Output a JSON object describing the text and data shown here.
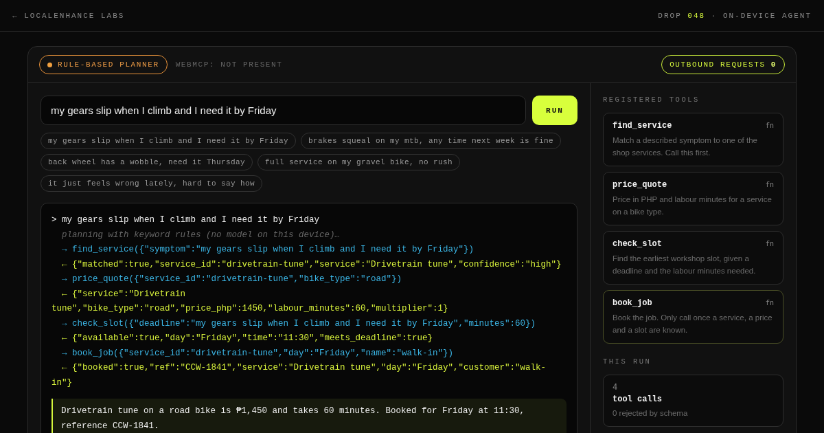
{
  "topbar": {
    "back_link": "← LOCALENHANCE LABS",
    "drop_label": "DROP",
    "drop_number": "048",
    "drop_suffix": "· ON-DEVICE AGENT"
  },
  "header": {
    "planner_badge": "RULE-BASED PLANNER",
    "webmcp_status": "WEBMCP: NOT PRESENT",
    "outbound_label": "OUTBOUND REQUESTS",
    "outbound_count": "0"
  },
  "prompt": {
    "value": "my gears slip when I climb and I need it by Friday",
    "run_button": "RUN"
  },
  "suggestions": [
    "my gears slip when I climb and I need it by Friday",
    "brakes squeal on my mtb, any time next week is fine",
    "back wheel has a wobble, need it Thursday",
    "full service on my gravel bike, no rush",
    "it just feels wrong lately, hard to say how"
  ],
  "log": [
    {
      "kind": "prompt",
      "text": "> my gears slip when I climb and I need it by Friday"
    },
    {
      "kind": "note",
      "text": "planning with keyword rules (no model on this device)…"
    },
    {
      "kind": "call",
      "text": "→ find_service({\"symptom\":\"my gears slip when I climb and I need it by Friday\"})"
    },
    {
      "kind": "result",
      "text": "← {\"matched\":true,\"service_id\":\"drivetrain-tune\",\"service\":\"Drivetrain tune\",\"confidence\":\"high\"}"
    },
    {
      "kind": "call",
      "text": "→ price_quote({\"service_id\":\"drivetrain-tune\",\"bike_type\":\"road\"})"
    },
    {
      "kind": "result",
      "text": "← {\"service\":\"Drivetrain tune\",\"bike_type\":\"road\",\"price_php\":1450,\"labour_minutes\":60,\"multiplier\":1}"
    },
    {
      "kind": "call",
      "text": "→ check_slot({\"deadline\":\"my gears slip when I climb and I need it by Friday\",\"minutes\":60})"
    },
    {
      "kind": "result",
      "text": "← {\"available\":true,\"day\":\"Friday\",\"time\":\"11:30\",\"meets_deadline\":true}"
    },
    {
      "kind": "call",
      "text": "→ book_job({\"service_id\":\"drivetrain-tune\",\"day\":\"Friday\",\"name\":\"walk-in\"})"
    },
    {
      "kind": "result",
      "text": "← {\"booked\":true,\"ref\":\"CCW-1841\",\"service\":\"Drivetrain tune\",\"day\":\"Friday\",\"customer\":\"walk-in\"}"
    }
  ],
  "answer": "Drivetrain tune on a road bike is ₱1,450 and takes 60 minutes. Booked for Friday at 11:30, reference CCW-1841.",
  "sidebar": {
    "tools_heading": "REGISTERED TOOLS",
    "tools": [
      {
        "name": "find_service",
        "tag": "fn",
        "description": "Match a described symptom to one of the shop services. Call this first.",
        "active": false
      },
      {
        "name": "price_quote",
        "tag": "fn",
        "description": "Price in PHP and labour minutes for a service on a bike type.",
        "active": false
      },
      {
        "name": "check_slot",
        "tag": "fn",
        "description": "Find the earliest workshop slot, given a deadline and the labour minutes needed.",
        "active": false
      },
      {
        "name": "book_job",
        "tag": "fn",
        "description": "Book the job. Only call once a service, a price and a slot are known.",
        "active": true
      }
    ],
    "run_heading": "THIS RUN",
    "stat": {
      "value": "4",
      "label": "tool calls",
      "note": "0 rejected by schema"
    }
  }
}
